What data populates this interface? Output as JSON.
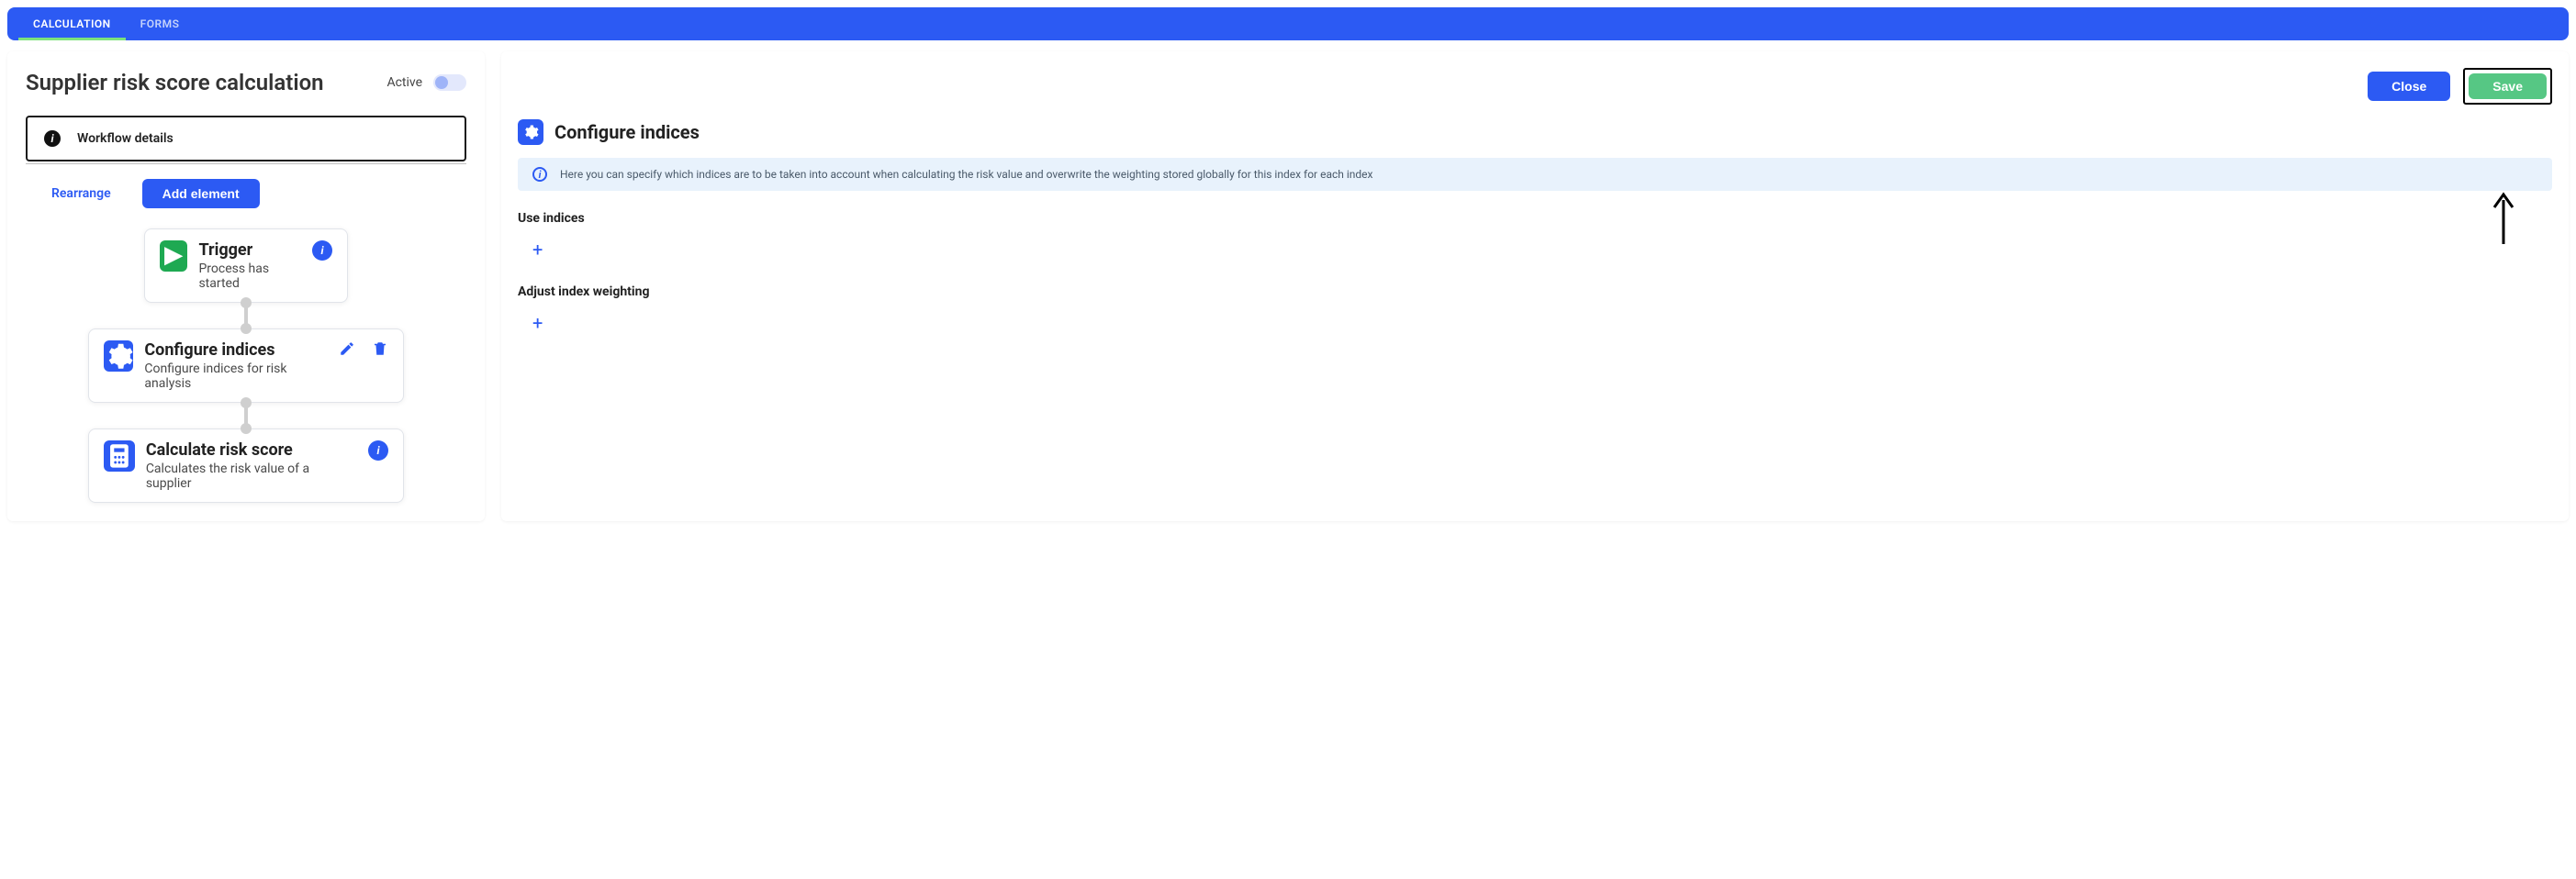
{
  "top_tabs": {
    "calculation": "CALCULATION",
    "forms": "FORMS"
  },
  "left": {
    "title": "Supplier risk score calculation",
    "active_label": "Active",
    "workflow_details": "Workflow details",
    "rearrange": "Rearrange",
    "add_element": "Add element"
  },
  "nodes": {
    "trigger": {
      "title": "Trigger",
      "sub": "Process has started"
    },
    "configure": {
      "title": "Configure indices",
      "sub": "Configure indices for risk analysis"
    },
    "calculate": {
      "title": "Calculate risk score",
      "sub": "Calculates the risk value of a supplier"
    }
  },
  "right": {
    "close": "Close",
    "save": "Save",
    "section_title": "Configure indices",
    "info_text": "Here you can specify which indices are to be taken into account when calculating the risk value and overwrite the weighting stored globally for this index for each index",
    "use_indices": "Use indices",
    "adjust_weighting": "Adjust index weighting"
  }
}
